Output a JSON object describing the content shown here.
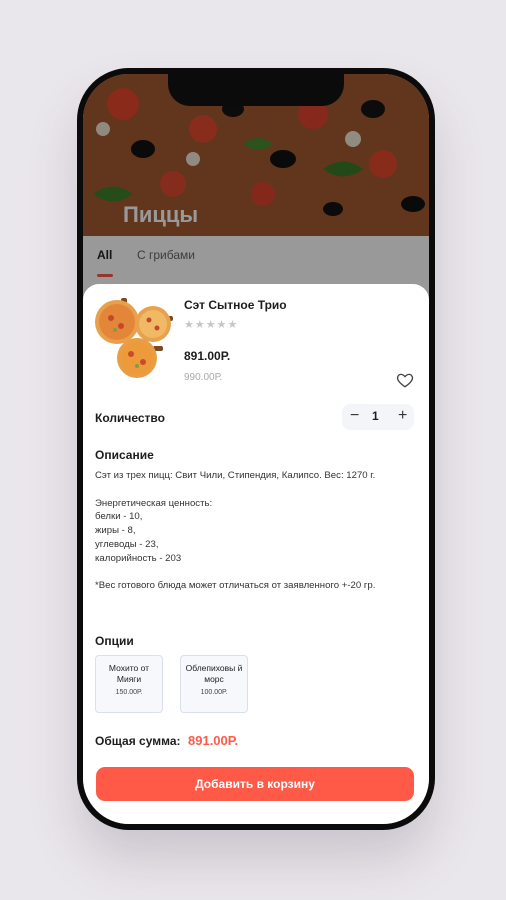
{
  "background_page": {
    "title": "Пиццы",
    "tabs": [
      "All",
      "С грибами"
    ]
  },
  "product": {
    "title": "Сэт Сытное Трио",
    "rating_stars": "★★★★★",
    "rating_value": 0,
    "price": "891.00Р.",
    "old_price": "990.00Р."
  },
  "quantity": {
    "label": "Количество",
    "minus": "−",
    "value": "1",
    "plus": "+"
  },
  "description": {
    "heading": "Описание",
    "text": "Сэт из трех пицц: Свит Чили, Стипендия, Калипсо. Вес: 1270 г.\n\nЭнергетическая ценность:\nбелки - 10,\nжиры - 8,\nуглеводы - 23,\nкалорийность - 203\n\n*Вес готового блюда может отличаться от заявленного +-20 гр."
  },
  "options": {
    "heading": "Опции",
    "items": [
      {
        "name": "Мохито от Мияги",
        "price": "150.00Р."
      },
      {
        "name": "Облепиховы й морс",
        "price": "100.00Р."
      }
    ]
  },
  "total": {
    "label": "Общая сумма:",
    "value": "891.00Р."
  },
  "cta_label": "Добавить в корзину",
  "colors": {
    "accent": "#ff5a48",
    "stars": "#c6c6c6"
  }
}
